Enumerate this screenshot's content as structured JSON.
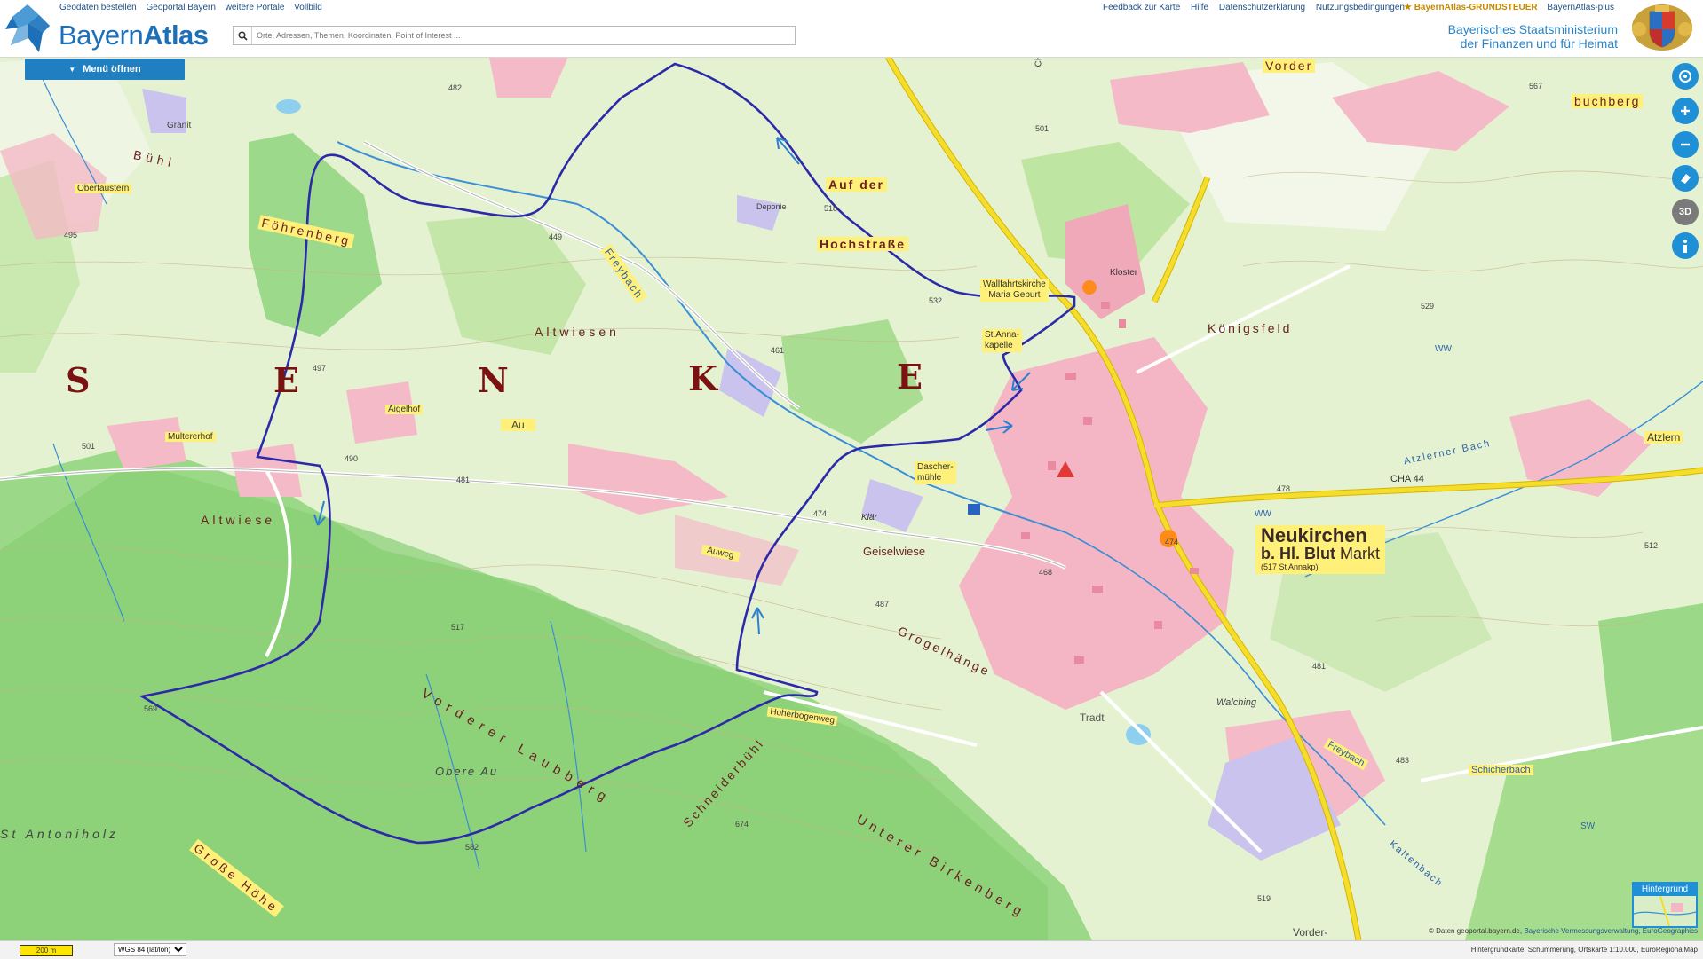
{
  "header": {
    "logo_text_regular": "Bayern",
    "logo_text_bold": "Atlas",
    "topnav": [
      "Geodaten bestellen",
      "Geoportal Bayern",
      "weitere Portale",
      "Vollbild"
    ],
    "search_placeholder": "Orte, Adressen, Themen, Koordinaten, Point of Interest ...",
    "rightnav": [
      "Feedback zur Karte",
      "Hilfe",
      "Datenschutzerklärung",
      "Nutzungsbedingungen"
    ],
    "grundsteuer": "★ BayernAtlas-GRUNDSTEUER",
    "plus": "BayernAtlas-plus",
    "ministry_line1": "Bayerisches Staatsministerium",
    "ministry_line2": "der Finanzen und für Heimat"
  },
  "menu": {
    "label": "Menü öffnen"
  },
  "controls": [
    "location-icon",
    "zoom-in-icon",
    "zoom-out-icon",
    "drawing-icon",
    "3d-icon",
    "info-icon"
  ],
  "controls_3d": "3D",
  "map_labels": {
    "big": [
      "S",
      "E",
      "N",
      "K",
      "E"
    ],
    "vorder": "Vorder",
    "buchberg": "buchberg",
    "auf_der": "Auf der",
    "hochstrasse": "Hochstraße",
    "foehrenberg": "Föhrenberg",
    "buehl": "Bühl",
    "oberfaustern": "Oberfaustern",
    "granit": "Granit",
    "altwiesen": "Altwiesen",
    "au": "Au",
    "aigelhof": "Aigelhof",
    "multererhof": "Multererhof",
    "altwiese": "Altwiese",
    "freybach": "Freybach",
    "deponie": "Deponie",
    "wallfahrtskirche": "Wallfahrtskirche",
    "maria_geburt": "Maria Geburt",
    "st_anna": "St.Anna-",
    "kapelle": "kapelle",
    "kloster": "Kloster",
    "koenigsfeld": "Königsfeld",
    "dascher": "Dascher-",
    "muehle": "mühle",
    "geiselwiese": "Geiselwiese",
    "auweg": "Auweg",
    "grogelhaenge": "Grogelhänge",
    "neukirchen": "Neukirchen",
    "bhlblut": "b. Hl. Blut",
    "markt": "Markt",
    "annakp": "(517 St Annakp)",
    "atzlern": "Atzlern",
    "cha44": "CHA 44",
    "atzlerner_bach": "Atzlerner Bach",
    "walching": "Walching",
    "freybach2": "Freybach",
    "schicherbach": "Schicherbach",
    "kaltenbach": "Kaltenbach",
    "tradt": "Tradt",
    "vorderer_laubberg": "Vorderer Laubberg",
    "schneiderbuehl": "Schneiderbühl",
    "unterer_birkenberg": "Unterer Birkenberg",
    "obere_au": "Obere Au",
    "st_antoniholz": "St Antoniholz",
    "grosse_hoehe": "Große Höhe",
    "hoherbogenweg": "Hoherbogenweg",
    "vorder_bottom": "Vorder-",
    "cha": "CHA",
    "klaer": "Klär",
    "ww": "WW",
    "sw": "SW",
    "ww2": "WW",
    "elevations": [
      "482",
      "495",
      "501",
      "449",
      "518",
      "532",
      "461",
      "497",
      "490",
      "481",
      "474",
      "487",
      "468",
      "474",
      "478",
      "512",
      "529",
      "567",
      "501",
      "569",
      "582",
      "674",
      "519",
      "481",
      "483",
      "517"
    ]
  },
  "footer": {
    "scale": "200 m",
    "crs": "WGS 84 (lat/lon)",
    "basemap": "Hintergrundkarte: Schummerung, Ortskarte 1:10.000, EuroRegionalMap"
  },
  "attribution": {
    "prefix": "© Daten geoportal.bayern.de,",
    "link": "Bayerische Vermessungsverwaltung, EuroGeographics"
  },
  "hintergrund": "Hintergrund",
  "colors": {
    "accent": "#1f7fc1",
    "forest": "#7fcf6e",
    "meadow": "#dff3c8",
    "settlement": "#f3a7b8",
    "road": "#f5dd2b",
    "route": "#2c2aa8",
    "water": "#3a8ed6"
  }
}
